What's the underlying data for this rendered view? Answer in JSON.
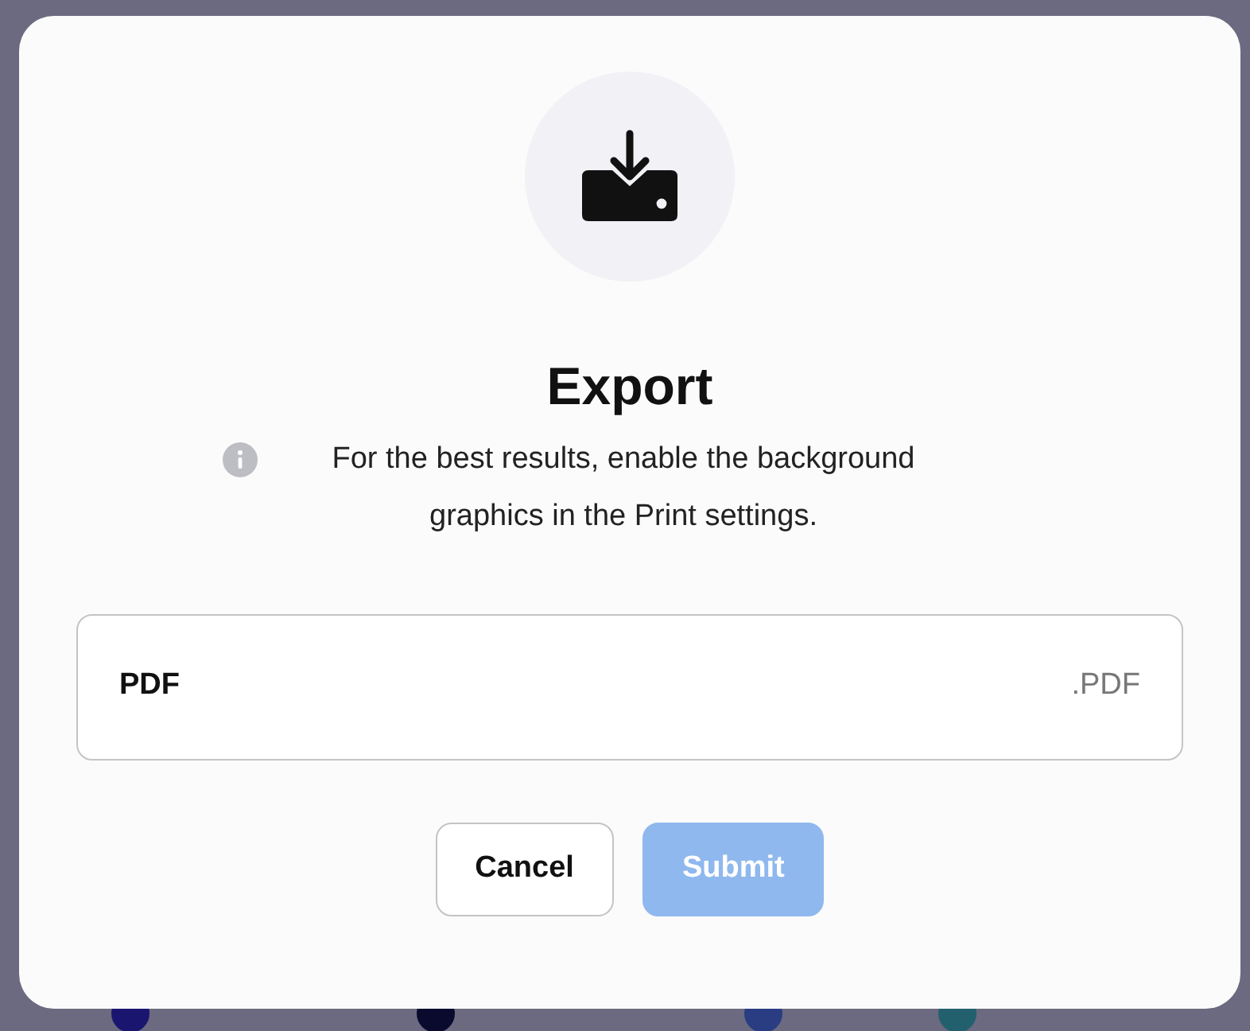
{
  "background_legend": [
    {
      "color": "#1a1670"
    },
    {
      "color": "#0a0a2e"
    },
    {
      "color": "#2a3c82"
    },
    {
      "color": "#22606e"
    }
  ],
  "dialog": {
    "title": "Export",
    "note": "For the best results, enable the background graphics in the Print settings.",
    "field": {
      "value": "PDF",
      "suffix": ".PDF"
    },
    "buttons": [
      {
        "label": "Cancel",
        "kind": "secondary",
        "disabled": false
      },
      {
        "label": "Submit",
        "kind": "primary",
        "disabled": true
      }
    ]
  }
}
